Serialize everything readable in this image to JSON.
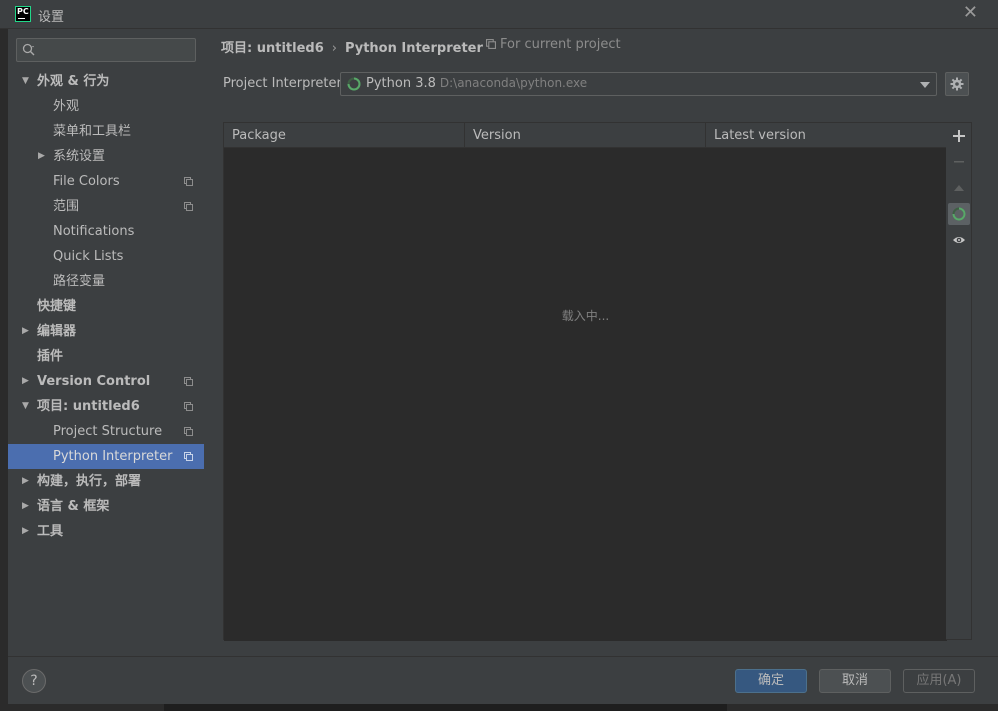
{
  "window": {
    "title": "设置",
    "app_logo_text": "PC"
  },
  "sidebar": {
    "search_placeholder": "",
    "items": [
      {
        "label": "外观 & 行为",
        "expanded": true,
        "bold": true,
        "level": 0,
        "has_arrow": true,
        "has_copy": false
      },
      {
        "label": "外观",
        "level": 1,
        "has_arrow": false,
        "has_copy": false
      },
      {
        "label": "菜单和工具栏",
        "level": 1,
        "has_arrow": false,
        "has_copy": false
      },
      {
        "label": "系统设置",
        "level": 1,
        "has_arrow": true,
        "expanded": false,
        "has_copy": false
      },
      {
        "label": "File Colors",
        "level": 1,
        "has_arrow": false,
        "has_copy": true
      },
      {
        "label": "范围",
        "level": 1,
        "has_arrow": false,
        "has_copy": true
      },
      {
        "label": "Notifications",
        "level": 1,
        "has_arrow": false,
        "has_copy": false
      },
      {
        "label": "Quick Lists",
        "level": 1,
        "has_arrow": false,
        "has_copy": false
      },
      {
        "label": "路径变量",
        "level": 1,
        "has_arrow": false,
        "has_copy": false
      },
      {
        "label": "快捷键",
        "bold": true,
        "level": 0,
        "has_arrow": false,
        "has_copy": false
      },
      {
        "label": "编辑器",
        "bold": true,
        "level": 0,
        "has_arrow": true,
        "expanded": false,
        "has_copy": false
      },
      {
        "label": "插件",
        "bold": true,
        "level": 0,
        "has_arrow": false,
        "has_copy": false
      },
      {
        "label": "Version Control",
        "bold": true,
        "level": 0,
        "has_arrow": true,
        "expanded": false,
        "has_copy": true
      },
      {
        "label": "项目: untitled6",
        "bold": true,
        "level": 0,
        "has_arrow": true,
        "expanded": true,
        "has_copy": true
      },
      {
        "label": "Project Structure",
        "level": 1,
        "has_arrow": false,
        "has_copy": true
      },
      {
        "label": "Python Interpreter",
        "level": 1,
        "has_arrow": false,
        "has_copy": true,
        "selected": true
      },
      {
        "label": "构建，执行，部署",
        "bold": true,
        "level": 0,
        "has_arrow": true,
        "expanded": false,
        "has_copy": false
      },
      {
        "label": "语言 & 框架",
        "bold": true,
        "level": 0,
        "has_arrow": true,
        "expanded": false,
        "has_copy": false
      },
      {
        "label": "工具",
        "bold": true,
        "level": 0,
        "has_arrow": true,
        "expanded": false,
        "has_copy": false
      }
    ]
  },
  "content": {
    "breadcrumb": {
      "project": "项目: untitled6",
      "separator": "›",
      "page": "Python Interpreter"
    },
    "scope": "For current project",
    "interpreter": {
      "label": "Project Interpreter:",
      "name": "Python 3.8",
      "path": "D:\\anaconda\\python.exe"
    },
    "table": {
      "columns": [
        "Package",
        "Version",
        "Latest version"
      ],
      "rows": [],
      "loading_text": "载入中..."
    },
    "toolbar": {
      "add": "add-icon",
      "remove": "remove-icon",
      "upgrade": "upgrade-icon",
      "loading": "loading-spinner-icon",
      "show_early": "eye-icon"
    }
  },
  "footer": {
    "help": "?",
    "ok": "确定",
    "cancel": "取消",
    "apply": "应用(A)"
  },
  "colors": {
    "selected": "#4b6eaf",
    "panel": "#3c3f41",
    "background": "#2b2b2b",
    "accent_green": "#499c54",
    "ok_button": "#365880"
  }
}
